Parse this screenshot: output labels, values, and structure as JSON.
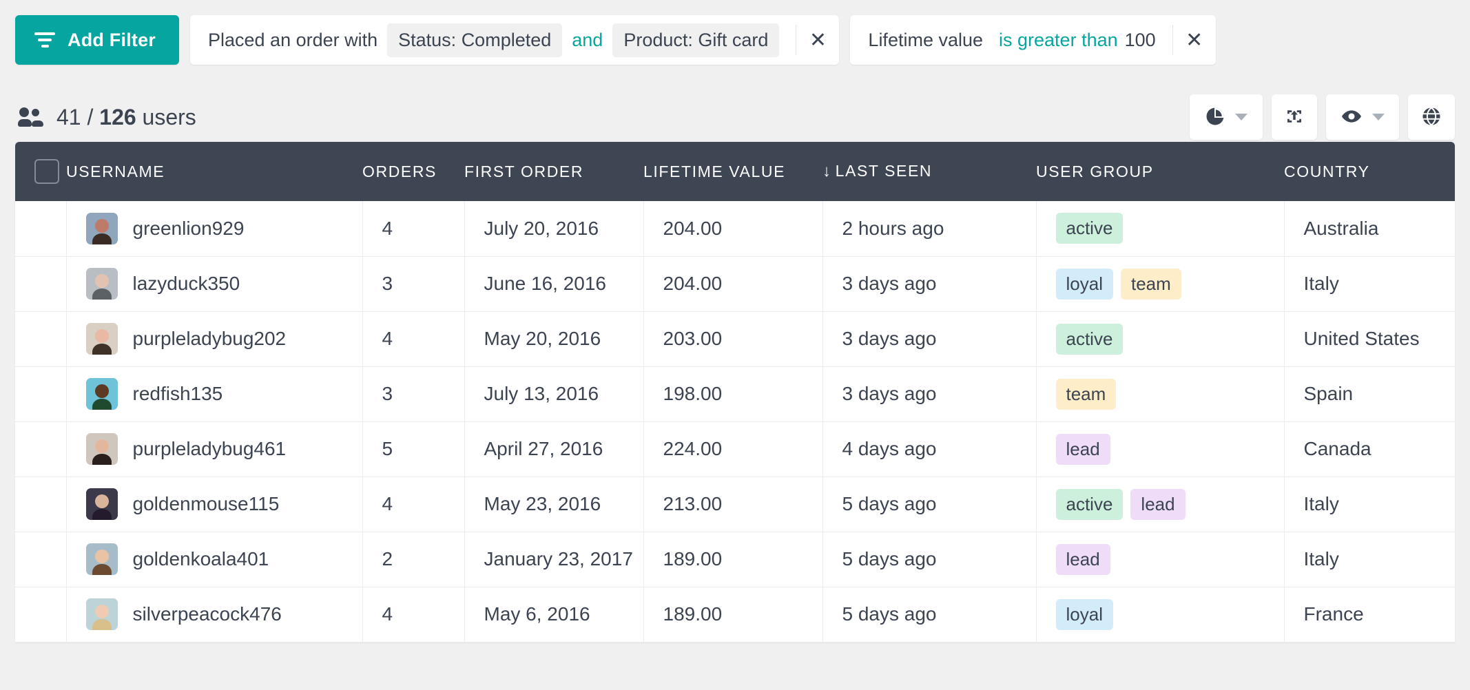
{
  "theme": {
    "accent": "#07a5a0",
    "header_bg": "#3e4653",
    "page_bg": "#f0f0f0",
    "text": "#3c4451"
  },
  "filter_bar": {
    "add_filter_label": "Add Filter",
    "filter_icon": "filter-icon",
    "cards": [
      {
        "prefix": "Placed an order with",
        "pills": [
          "Status: Completed",
          "Product: Gift card"
        ],
        "conjunction": "and",
        "close_icon": "close-icon"
      },
      {
        "subject": "Lifetime value",
        "operator": "is greater than",
        "value": "100",
        "close_icon": "close-icon"
      }
    ]
  },
  "count_row": {
    "icon": "users-icon",
    "shown": "41",
    "separator": "/",
    "total": "126",
    "unit": "users",
    "toolbar": [
      {
        "name": "chart-view-button",
        "icon": "pie-chart-icon",
        "has_caret": true
      },
      {
        "name": "export-button",
        "icon": "export-box-icon",
        "has_caret": false
      },
      {
        "name": "visibility-button",
        "icon": "eye-icon",
        "has_caret": true
      },
      {
        "name": "globe-button",
        "icon": "globe-icon",
        "has_caret": false
      }
    ]
  },
  "table": {
    "select_all_checkbox": "select-all-checkbox",
    "sort_column": "LAST SEEN",
    "sort_direction_glyph": "↓",
    "columns": [
      "USERNAME",
      "ORDERS",
      "FIRST ORDER",
      "LIFETIME VALUE",
      "LAST SEEN",
      "USER GROUP",
      "COUNTRY"
    ],
    "rows": [
      {
        "username": "greenlion929",
        "orders": "4",
        "first_order": "July 20, 2016",
        "lifetime_value": "204.00",
        "last_seen": "2 hours ago",
        "groups": [
          "active"
        ],
        "country": "Australia",
        "avatar": "avatar-photo-man-glasses-red-shirt"
      },
      {
        "username": "lazyduck350",
        "orders": "3",
        "first_order": "June 16, 2016",
        "lifetime_value": "204.00",
        "last_seen": "3 days ago",
        "groups": [
          "loyal",
          "team"
        ],
        "country": "Italy",
        "avatar": "avatar-photo-bald-man"
      },
      {
        "username": "purpleladybug202",
        "orders": "4",
        "first_order": "May 20, 2016",
        "lifetime_value": "203.00",
        "last_seen": "3 days ago",
        "groups": [
          "active"
        ],
        "country": "United States",
        "avatar": "avatar-photo-smiling-woman"
      },
      {
        "username": "redfish135",
        "orders": "3",
        "first_order": "July 13, 2016",
        "lifetime_value": "198.00",
        "last_seen": "3 days ago",
        "groups": [
          "team"
        ],
        "country": "Spain",
        "avatar": "avatar-photo-man-blue-jacket"
      },
      {
        "username": "purpleladybug461",
        "orders": "5",
        "first_order": "April 27, 2016",
        "lifetime_value": "224.00",
        "last_seen": "4 days ago",
        "groups": [
          "lead"
        ],
        "country": "Canada",
        "avatar": "avatar-photo-woman-dark-hair"
      },
      {
        "username": "goldenmouse115",
        "orders": "4",
        "first_order": "May 23, 2016",
        "lifetime_value": "213.00",
        "last_seen": "5 days ago",
        "groups": [
          "active",
          "lead"
        ],
        "country": "Italy",
        "avatar": "avatar-photo-person-indoors"
      },
      {
        "username": "goldenkoala401",
        "orders": "2",
        "first_order": "January 23, 2017",
        "lifetime_value": "189.00",
        "last_seen": "5 days ago",
        "groups": [
          "lead"
        ],
        "country": "Italy",
        "avatar": "avatar-photo-woman-brown-hair"
      },
      {
        "username": "silverpeacock476",
        "orders": "4",
        "first_order": "May 6, 2016",
        "lifetime_value": "189.00",
        "last_seen": "5 days ago",
        "groups": [
          "loyal"
        ],
        "country": "France",
        "avatar": "avatar-photo-blonde-woman"
      }
    ]
  },
  "badge_colors": {
    "active": "#cdf0dc",
    "loyal": "#d3ecf9",
    "team": "#fdeec9",
    "lead": "#eedcf8"
  }
}
